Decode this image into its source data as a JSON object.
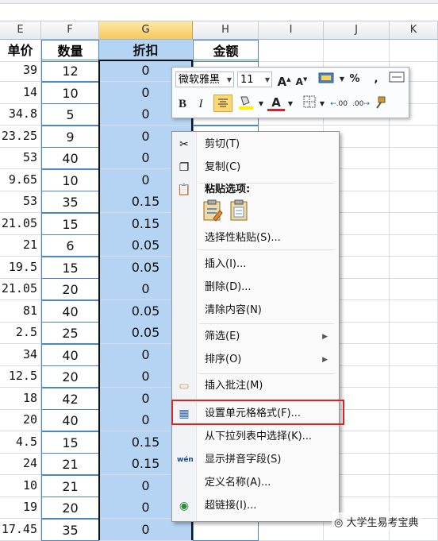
{
  "columns": [
    "E",
    "F",
    "G",
    "H",
    "I",
    "J",
    "K"
  ],
  "headers": {
    "e": "单价",
    "f": "数量",
    "g": "折扣",
    "h": "金额"
  },
  "rows": [
    {
      "e": "39",
      "f": "12",
      "g": "0"
    },
    {
      "e": "14",
      "f": "10",
      "g": "0"
    },
    {
      "e": "34.8",
      "f": "5",
      "g": "0"
    },
    {
      "e": "23.25",
      "f": "9",
      "g": "0"
    },
    {
      "e": "53",
      "f": "40",
      "g": "0"
    },
    {
      "e": "9.65",
      "f": "10",
      "g": "0"
    },
    {
      "e": "53",
      "f": "35",
      "g": "0.15"
    },
    {
      "e": "21.05",
      "f": "15",
      "g": "0.15"
    },
    {
      "e": "21",
      "f": "6",
      "g": "0.05"
    },
    {
      "e": "19.5",
      "f": "15",
      "g": "0.05"
    },
    {
      "e": "21.05",
      "f": "20",
      "g": "0"
    },
    {
      "e": "81",
      "f": "40",
      "g": "0.05"
    },
    {
      "e": "2.5",
      "f": "25",
      "g": "0.05"
    },
    {
      "e": "34",
      "f": "40",
      "g": "0"
    },
    {
      "e": "12.5",
      "f": "20",
      "g": "0"
    },
    {
      "e": "18",
      "f": "42",
      "g": "0"
    },
    {
      "e": "20",
      "f": "40",
      "g": "0"
    },
    {
      "e": "4.5",
      "f": "15",
      "g": "0.15"
    },
    {
      "e": "24",
      "f": "21",
      "g": "0.15"
    },
    {
      "e": "10",
      "f": "21",
      "g": "0"
    },
    {
      "e": "19",
      "f": "20",
      "g": "0"
    },
    {
      "e": "17.45",
      "f": "35",
      "g": "0"
    }
  ],
  "mini_toolbar": {
    "font_name": "微软雅黑",
    "font_size": "11",
    "grow": "A",
    "shrink": "A",
    "percent": "%",
    "comma": ",",
    "bold": "B",
    "italic": "I",
    "decimal_inc": ".00",
    "decimal_dec": ".00"
  },
  "context_menu": [
    {
      "label": "剪切(T)",
      "icon": "scissors-icon"
    },
    {
      "label": "复制(C)",
      "icon": "copy-icon"
    },
    {
      "label": "粘贴选项:",
      "icon": "paste-icon"
    },
    {
      "label": "选择性粘贴(S)...",
      "icon": ""
    },
    {
      "label": "插入(I)...",
      "icon": ""
    },
    {
      "label": "删除(D)...",
      "icon": ""
    },
    {
      "label": "清除内容(N)",
      "icon": ""
    },
    {
      "label": "筛选(E)",
      "icon": "",
      "submenu": true
    },
    {
      "label": "排序(O)",
      "icon": "",
      "submenu": true
    },
    {
      "label": "插入批注(M)",
      "icon": "comment-icon"
    },
    {
      "label": "设置单元格格式(F)...",
      "icon": "format-cells-icon"
    },
    {
      "label": "从下拉列表中选择(K)...",
      "icon": ""
    },
    {
      "label": "显示拼音字段(S)",
      "icon": "phonetic-icon"
    },
    {
      "label": "定义名称(A)...",
      "icon": ""
    },
    {
      "label": "超链接(I)...",
      "icon": "hyperlink-icon"
    }
  ],
  "watermark": "大学生易考宝典",
  "colors": {
    "selected_fill": "#b5d4f3",
    "highlight_box": "#e0221a",
    "header_selected": "#f7c95c"
  }
}
